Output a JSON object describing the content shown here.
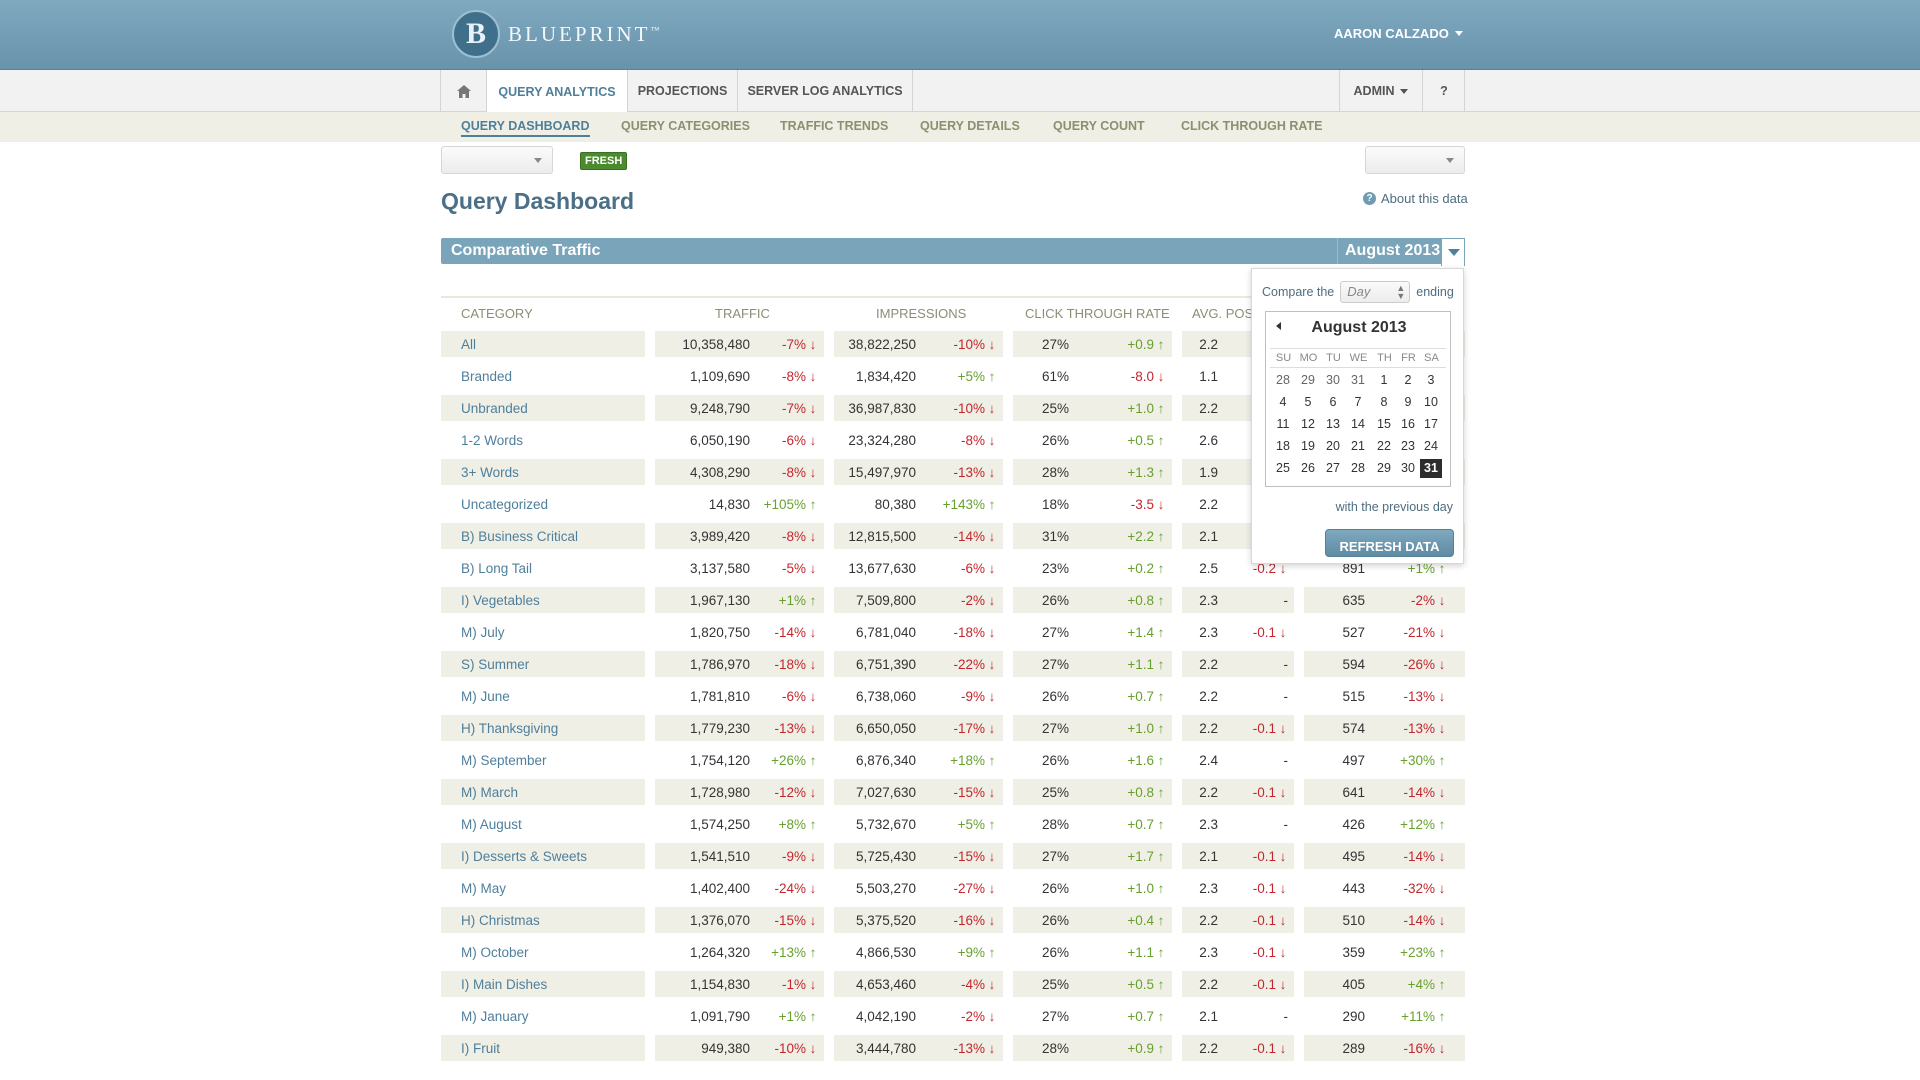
{
  "header": {
    "logo_letter": "B",
    "logo_text": "BLUEPRINT",
    "logo_tm": "™",
    "user": "AARON CALZADO"
  },
  "nav": {
    "home_icon": "home-icon",
    "query_analytics": "QUERY ANALYTICS",
    "projections": "PROJECTIONS",
    "server_log": "SERVER LOG ANALYTICS",
    "admin": "ADMIN",
    "help": "?"
  },
  "subnav": [
    "QUERY DASHBOARD",
    "QUERY CATEGORIES",
    "TRAFFIC TRENDS",
    "QUERY DETAILS",
    "QUERY COUNT",
    "CLICK THROUGH RATE"
  ],
  "fresh_badge": "FRESH",
  "page_title": "Query Dashboard",
  "about_link": "About this data",
  "section": {
    "title": "Comparative Traffic",
    "period": "August 2013"
  },
  "columns": [
    "CATEGORY",
    "TRAFFIC",
    "IMPRESSIONS",
    "CLICK THROUGH RATE",
    "AVG. POSI"
  ],
  "rows": [
    {
      "cat": "All",
      "traffic": "10,358,480",
      "t_d": "-7%",
      "imp": "38,822,250",
      "i_d": "-10%",
      "ctr": "27%",
      "c_d": "+0.9",
      "pos": "2.2",
      "p_d": "",
      "extra": "",
      "e_d": ""
    },
    {
      "cat": "Branded",
      "traffic": "1,109,690",
      "t_d": "-8%",
      "imp": "1,834,420",
      "i_d": "+5%",
      "ctr": "61%",
      "c_d": "-8.0",
      "pos": "1.1",
      "p_d": "",
      "extra": "",
      "e_d": ""
    },
    {
      "cat": "Unbranded",
      "traffic": "9,248,790",
      "t_d": "-7%",
      "imp": "36,987,830",
      "i_d": "-10%",
      "ctr": "25%",
      "c_d": "+1.0",
      "pos": "2.2",
      "p_d": "",
      "extra": "",
      "e_d": ""
    },
    {
      "cat": "1-2 Words",
      "traffic": "6,050,190",
      "t_d": "-6%",
      "imp": "23,324,280",
      "i_d": "-8%",
      "ctr": "26%",
      "c_d": "+0.5",
      "pos": "2.6",
      "p_d": "",
      "extra": "",
      "e_d": ""
    },
    {
      "cat": "3+ Words",
      "traffic": "4,308,290",
      "t_d": "-8%",
      "imp": "15,497,970",
      "i_d": "-13%",
      "ctr": "28%",
      "c_d": "+1.3",
      "pos": "1.9",
      "p_d": "",
      "extra": "",
      "e_d": ""
    },
    {
      "cat": "Uncategorized",
      "traffic": "14,830",
      "t_d": "+105%",
      "imp": "80,380",
      "i_d": "+143%",
      "ctr": "18%",
      "c_d": "-3.5",
      "pos": "2.2",
      "p_d": "",
      "extra": "",
      "e_d": ""
    },
    {
      "cat": "B) Business Critical",
      "traffic": "3,989,420",
      "t_d": "-8%",
      "imp": "12,815,500",
      "i_d": "-14%",
      "ctr": "31%",
      "c_d": "+2.2",
      "pos": "2.1",
      "p_d": "",
      "extra": "",
      "e_d": ""
    },
    {
      "cat": "B) Long Tail",
      "traffic": "3,137,580",
      "t_d": "-5%",
      "imp": "13,677,630",
      "i_d": "-6%",
      "ctr": "23%",
      "c_d": "+0.2",
      "pos": "2.5",
      "p_d": "-0.2",
      "extra": "891",
      "e_d": "+1%"
    },
    {
      "cat": "I) Vegetables",
      "traffic": "1,967,130",
      "t_d": "+1%",
      "imp": "7,509,800",
      "i_d": "-2%",
      "ctr": "26%",
      "c_d": "+0.8",
      "pos": "2.3",
      "p_d": "-",
      "extra": "635",
      "e_d": "-2%"
    },
    {
      "cat": "M) July",
      "traffic": "1,820,750",
      "t_d": "-14%",
      "imp": "6,781,040",
      "i_d": "-18%",
      "ctr": "27%",
      "c_d": "+1.4",
      "pos": "2.3",
      "p_d": "-0.1",
      "extra": "527",
      "e_d": "-21%"
    },
    {
      "cat": "S) Summer",
      "traffic": "1,786,970",
      "t_d": "-18%",
      "imp": "6,751,390",
      "i_d": "-22%",
      "ctr": "27%",
      "c_d": "+1.1",
      "pos": "2.2",
      "p_d": "-",
      "extra": "594",
      "e_d": "-26%"
    },
    {
      "cat": "M) June",
      "traffic": "1,781,810",
      "t_d": "-6%",
      "imp": "6,738,060",
      "i_d": "-9%",
      "ctr": "26%",
      "c_d": "+0.7",
      "pos": "2.2",
      "p_d": "-",
      "extra": "515",
      "e_d": "-13%"
    },
    {
      "cat": "H) Thanksgiving",
      "traffic": "1,779,230",
      "t_d": "-13%",
      "imp": "6,650,050",
      "i_d": "-17%",
      "ctr": "27%",
      "c_d": "+1.0",
      "pos": "2.2",
      "p_d": "-0.1",
      "extra": "574",
      "e_d": "-13%"
    },
    {
      "cat": "M) September",
      "traffic": "1,754,120",
      "t_d": "+26%",
      "imp": "6,876,340",
      "i_d": "+18%",
      "ctr": "26%",
      "c_d": "+1.6",
      "pos": "2.4",
      "p_d": "-",
      "extra": "497",
      "e_d": "+30%"
    },
    {
      "cat": "M) March",
      "traffic": "1,728,980",
      "t_d": "-12%",
      "imp": "7,027,630",
      "i_d": "-15%",
      "ctr": "25%",
      "c_d": "+0.8",
      "pos": "2.2",
      "p_d": "-0.1",
      "extra": "641",
      "e_d": "-14%"
    },
    {
      "cat": "M) August",
      "traffic": "1,574,250",
      "t_d": "+8%",
      "imp": "5,732,670",
      "i_d": "+5%",
      "ctr": "28%",
      "c_d": "+0.7",
      "pos": "2.3",
      "p_d": "-",
      "extra": "426",
      "e_d": "+12%"
    },
    {
      "cat": "I) Desserts & Sweets",
      "traffic": "1,541,510",
      "t_d": "-9%",
      "imp": "5,725,430",
      "i_d": "-15%",
      "ctr": "27%",
      "c_d": "+1.7",
      "pos": "2.1",
      "p_d": "-0.1",
      "extra": "495",
      "e_d": "-14%"
    },
    {
      "cat": "M) May",
      "traffic": "1,402,400",
      "t_d": "-24%",
      "imp": "5,503,270",
      "i_d": "-27%",
      "ctr": "26%",
      "c_d": "+1.0",
      "pos": "2.3",
      "p_d": "-0.1",
      "extra": "443",
      "e_d": "-32%"
    },
    {
      "cat": "H) Christmas",
      "traffic": "1,376,070",
      "t_d": "-15%",
      "imp": "5,375,520",
      "i_d": "-16%",
      "ctr": "26%",
      "c_d": "+0.4",
      "pos": "2.2",
      "p_d": "-0.1",
      "extra": "510",
      "e_d": "-14%"
    },
    {
      "cat": "M) October",
      "traffic": "1,264,320",
      "t_d": "+13%",
      "imp": "4,866,530",
      "i_d": "+9%",
      "ctr": "26%",
      "c_d": "+1.1",
      "pos": "2.3",
      "p_d": "-0.1",
      "extra": "359",
      "e_d": "+23%"
    },
    {
      "cat": "I) Main Dishes",
      "traffic": "1,154,830",
      "t_d": "-1%",
      "imp": "4,653,460",
      "i_d": "-4%",
      "ctr": "25%",
      "c_d": "+0.5",
      "pos": "2.2",
      "p_d": "-0.1",
      "extra": "405",
      "e_d": "+4%"
    },
    {
      "cat": "M) January",
      "traffic": "1,091,790",
      "t_d": "+1%",
      "imp": "4,042,190",
      "i_d": "-2%",
      "ctr": "27%",
      "c_d": "+0.7",
      "pos": "2.1",
      "p_d": "-",
      "extra": "290",
      "e_d": "+11%"
    },
    {
      "cat": "I) Fruit",
      "traffic": "949,380",
      "t_d": "-10%",
      "imp": "3,444,780",
      "i_d": "-13%",
      "ctr": "28%",
      "c_d": "+0.9",
      "pos": "2.2",
      "p_d": "-0.1",
      "extra": "289",
      "e_d": "-16%"
    }
  ],
  "popover": {
    "compare_label": "Compare the",
    "unit_placeholder": "Day",
    "ending_label": "ending",
    "month_title": "August 2013",
    "dow": [
      "SU",
      "MO",
      "TU",
      "WE",
      "TH",
      "FR",
      "SA"
    ],
    "weeks": [
      [
        "28",
        "29",
        "30",
        "31",
        "1",
        "2",
        "3"
      ],
      [
        "4",
        "5",
        "6",
        "7",
        "8",
        "9",
        "10"
      ],
      [
        "11",
        "12",
        "13",
        "14",
        "15",
        "16",
        "17"
      ],
      [
        "18",
        "19",
        "20",
        "21",
        "22",
        "23",
        "24"
      ],
      [
        "25",
        "26",
        "27",
        "28",
        "29",
        "30",
        "31"
      ]
    ],
    "selected_day": "31",
    "previous_note": "with the previous day",
    "refresh_label": "REFRESH DATA"
  },
  "colors": {
    "up": "#66a12e",
    "down": "#c1272d",
    "accent": "#79a4ba",
    "link": "#4e7f9b"
  }
}
